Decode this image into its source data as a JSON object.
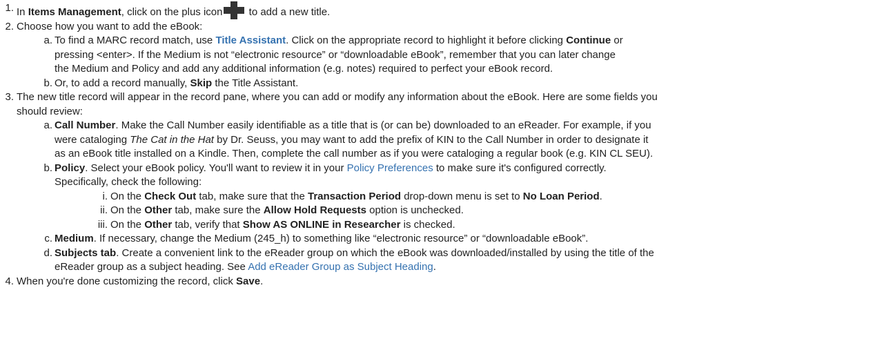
{
  "steps": {
    "s1": {
      "num": "1.",
      "t1": "In ",
      "b1": "Items Management",
      "t2": ", click on the plus icon",
      "icon": "plus-icon",
      "t3": " to add a new title."
    },
    "s2": {
      "num": "2.",
      "text": "Choose how you want to add the eBook:",
      "a": {
        "num": "a.",
        "t1": "To find a MARC record match, use ",
        "link": "Title Assistant",
        "t2": ". Click on the appropriate record to highlight it before clicking ",
        "b1": "Continue",
        "t3": " or",
        "line2": "pressing <enter>.  If the Medium is not “electronic resource” or “downloadable eBook”, remember that you can later change",
        "line3": "the Medium and Policy and add any additional information (e.g. notes) required to perfect your eBook record."
      },
      "b": {
        "num": "b.",
        "t1": "Or, to add a record manually, ",
        "b1": "Skip",
        "t2": " the Title Assistant."
      }
    },
    "s3": {
      "num": "3.",
      "line1": "The new title record will appear in the record pane, where you can add or modify any information about the eBook. Here are some fields you",
      "line2": "should review:",
      "a": {
        "num": "a.",
        "b1": "Call Number",
        "t1": ". Make the Call Number easily identifiable as a title that is (or can be) downloaded to an eReader. For example, if you",
        "l2a": "were cataloging ",
        "i1": "The Cat in the Hat",
        "l2b": " by Dr. Seuss, you may want to add the prefix of KIN to the Call Number in order to designate it",
        "line3": "as an eBook title installed on a Kindle. Then, complete the call number as if you were cataloging a regular book (e.g. KIN CL SEU)."
      },
      "b": {
        "num": "b.",
        "b1": "Policy",
        "t1": ". Select your eBook policy. You'll want to review it in your ",
        "link": "Policy Preferences",
        "t2": " to make sure it's configured correctly.",
        "line2": "Specifically, check the following:",
        "i": {
          "num": "i.",
          "t1": "On the ",
          "b1": "Check Out",
          "t2": " tab, make sure that the ",
          "b2": "Transaction Period",
          "t3": " drop-down menu is set to ",
          "b3": "No Loan Period",
          "t4": "."
        },
        "ii": {
          "num": "ii.",
          "t1": "On the ",
          "b1": "Other",
          "t2": " tab, make sure the ",
          "b2": "Allow Hold Requests",
          "t3": " option is unchecked."
        },
        "iii": {
          "num": "iii.",
          "t1": "On the ",
          "b1": "Other",
          "t2": " tab, verify that ",
          "b2": "Show AS ONLINE in Researcher",
          "t3": " is checked."
        }
      },
      "c": {
        "num": "c.",
        "b1": "Medium",
        "t1": ". If necessary, change the Medium (245_h) to something like “electronic resource” or “downloadable eBook”."
      },
      "d": {
        "num": "d.",
        "b1": "Subjects tab",
        "t1": ". Create a convenient link to the eReader group on which the eBook was downloaded/installed by using the title of the",
        "l2a": "eReader group as a subject heading. See ",
        "link": "Add eReader Group as Subject Heading",
        "l2b": "."
      }
    },
    "s4": {
      "num": "4.",
      "t1": "When you're done customizing the record, click ",
      "b1": "Save",
      "t2": "."
    }
  },
  "colors": {
    "text": "#222222",
    "link": "#3572b0",
    "icon": "#333333"
  }
}
